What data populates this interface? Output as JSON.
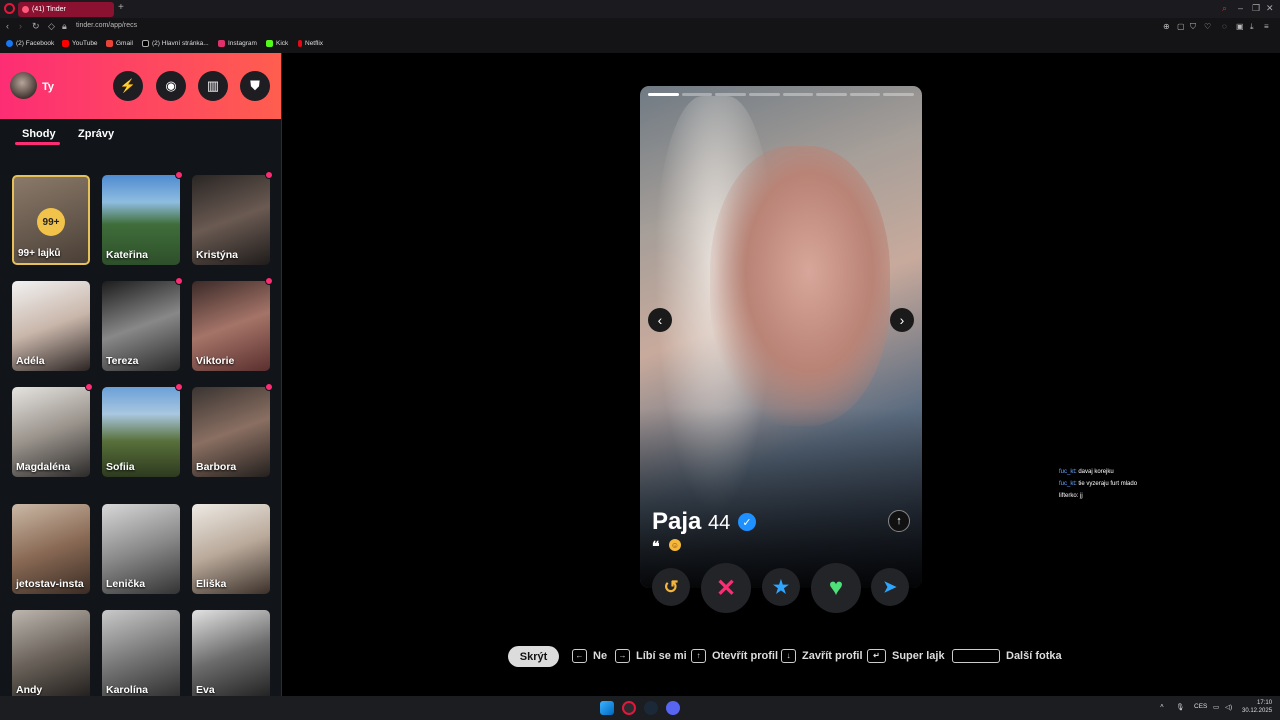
{
  "browser": {
    "tab_title": "(41) Tinder",
    "url": "tinder.com/app/recs",
    "bookmarks": [
      "(2) Facebook",
      "YouTube",
      "Gmail",
      "(2) Hlavní stránka...",
      "Instagram",
      "Kick",
      "Netflix"
    ]
  },
  "sidebar": {
    "user_name": "Ty",
    "tabs": [
      "Shody",
      "Zprávy"
    ],
    "likes_badge": "99+",
    "likes_label": "99+ lajků",
    "matches": [
      "Kateřina",
      "Kristýna",
      "Adéla",
      "Tereza",
      "Viktorie",
      "Magdaléna",
      "Sofiia",
      "Barbora",
      "jetostav-insta",
      "Lenička",
      "Eliška",
      "Andy",
      "Karolína",
      "Eva"
    ]
  },
  "profile": {
    "name": "Paja",
    "age": "44",
    "quote_mark": "❝",
    "photo_count": 8,
    "current_photo": 1
  },
  "hints": {
    "hide": "Skrýt",
    "no": "Ne",
    "like": "Líbí se mi",
    "open_profile": "Otevřít profil",
    "close_profile": "Zavřít profil",
    "super_like": "Super lajk",
    "next_photo": "Další fotka"
  },
  "chat": [
    {
      "user": "fuc_kt",
      "text": ": davaj korejku"
    },
    {
      "user": "fuc_kt",
      "text": ": tie vyzeraju furt mlado"
    },
    {
      "user": "lifterko",
      "text": ": jj"
    }
  ],
  "taskbar": {
    "lang": "CES",
    "time": "17:10",
    "date": "30.12.2025"
  },
  "colors": {
    "brand_start": "#fd2d74",
    "brand_end": "#ff5e4f"
  }
}
